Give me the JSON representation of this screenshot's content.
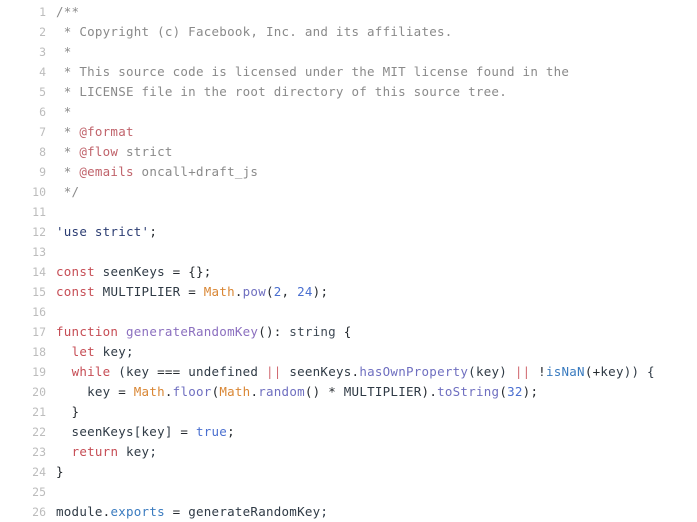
{
  "editor": {
    "language": "javascript",
    "background_color": "#ffffff",
    "gutter_color": "#bcbcbc",
    "default_text_color": "#24292e",
    "total_lines": 26
  },
  "colors": {
    "comment": "#8a8a8a",
    "doc_tag": "#c0636b",
    "keyword": "#c64d55",
    "string": "#2b3c72",
    "builtin_object": "#d98634",
    "method": "#6f6fc0",
    "function_name": "#8b6fbf",
    "property": "#3a7bbf",
    "constant": "#4a6fd0",
    "operator": "#d16b72"
  },
  "lines": [
    {
      "n": "1",
      "tokens": [
        {
          "t": "/**",
          "c": "comment"
        }
      ]
    },
    {
      "n": "2",
      "tokens": [
        {
          "t": " * Copyright (c) Facebook, Inc. and its affiliates.",
          "c": "comment"
        }
      ]
    },
    {
      "n": "3",
      "tokens": [
        {
          "t": " *",
          "c": "comment"
        }
      ]
    },
    {
      "n": "4",
      "tokens": [
        {
          "t": " * This source code is licensed under the MIT license found in the",
          "c": "comment"
        }
      ]
    },
    {
      "n": "5",
      "tokens": [
        {
          "t": " * LICENSE file in the root directory of this source tree.",
          "c": "comment"
        }
      ]
    },
    {
      "n": "6",
      "tokens": [
        {
          "t": " *",
          "c": "comment"
        }
      ]
    },
    {
      "n": "7",
      "tokens": [
        {
          "t": " * ",
          "c": "comment"
        },
        {
          "t": "@format",
          "c": "doctag"
        }
      ]
    },
    {
      "n": "8",
      "tokens": [
        {
          "t": " * ",
          "c": "comment"
        },
        {
          "t": "@flow",
          "c": "doctag"
        },
        {
          "t": " strict",
          "c": "comment"
        }
      ]
    },
    {
      "n": "9",
      "tokens": [
        {
          "t": " * ",
          "c": "comment"
        },
        {
          "t": "@emails",
          "c": "doctag"
        },
        {
          "t": " oncall+draft_js",
          "c": "comment"
        }
      ]
    },
    {
      "n": "10",
      "tokens": [
        {
          "t": " */",
          "c": "comment"
        }
      ]
    },
    {
      "n": "11",
      "tokens": []
    },
    {
      "n": "12",
      "tokens": [
        {
          "t": "'use strict'",
          "c": "string"
        },
        {
          "t": ";",
          "c": "plain"
        }
      ]
    },
    {
      "n": "13",
      "tokens": []
    },
    {
      "n": "14",
      "tokens": [
        {
          "t": "const",
          "c": "keyword"
        },
        {
          "t": " seenKeys ",
          "c": "ident"
        },
        {
          "t": "=",
          "c": "plain"
        },
        {
          "t": " {};",
          "c": "plain"
        }
      ]
    },
    {
      "n": "15",
      "tokens": [
        {
          "t": "const",
          "c": "keyword"
        },
        {
          "t": " MULTIPLIER ",
          "c": "ident"
        },
        {
          "t": "=",
          "c": "plain"
        },
        {
          "t": " ",
          "c": "plain"
        },
        {
          "t": "Math",
          "c": "builtin"
        },
        {
          "t": ".",
          "c": "plain"
        },
        {
          "t": "pow",
          "c": "method"
        },
        {
          "t": "(",
          "c": "plain"
        },
        {
          "t": "2",
          "c": "const"
        },
        {
          "t": ", ",
          "c": "plain"
        },
        {
          "t": "24",
          "c": "const"
        },
        {
          "t": ");",
          "c": "plain"
        }
      ]
    },
    {
      "n": "16",
      "tokens": []
    },
    {
      "n": "17",
      "tokens": [
        {
          "t": "function",
          "c": "keyword"
        },
        {
          "t": " ",
          "c": "plain"
        },
        {
          "t": "generateRandomKey",
          "c": "func"
        },
        {
          "t": "(): ",
          "c": "plain"
        },
        {
          "t": "string",
          "c": "type"
        },
        {
          "t": " {",
          "c": "plain"
        }
      ]
    },
    {
      "n": "18",
      "tokens": [
        {
          "t": "  ",
          "c": "plain"
        },
        {
          "t": "let",
          "c": "keyword"
        },
        {
          "t": " key;",
          "c": "ident"
        }
      ]
    },
    {
      "n": "19",
      "tokens": [
        {
          "t": "  ",
          "c": "plain"
        },
        {
          "t": "while",
          "c": "keyword"
        },
        {
          "t": " (key ",
          "c": "ident"
        },
        {
          "t": "===",
          "c": "plain"
        },
        {
          "t": " undefined ",
          "c": "ident"
        },
        {
          "t": "||",
          "c": "op"
        },
        {
          "t": " seenKeys",
          "c": "ident"
        },
        {
          "t": ".",
          "c": "plain"
        },
        {
          "t": "hasOwnProperty",
          "c": "method"
        },
        {
          "t": "(key) ",
          "c": "ident"
        },
        {
          "t": "||",
          "c": "op"
        },
        {
          "t": " ",
          "c": "plain"
        },
        {
          "t": "!",
          "c": "plain"
        },
        {
          "t": "isNaN",
          "c": "prop"
        },
        {
          "t": "(",
          "c": "plain"
        },
        {
          "t": "+",
          "c": "plain"
        },
        {
          "t": "key)) {",
          "c": "ident"
        }
      ]
    },
    {
      "n": "20",
      "tokens": [
        {
          "t": "    key ",
          "c": "ident"
        },
        {
          "t": "=",
          "c": "plain"
        },
        {
          "t": " ",
          "c": "plain"
        },
        {
          "t": "Math",
          "c": "builtin"
        },
        {
          "t": ".",
          "c": "plain"
        },
        {
          "t": "floor",
          "c": "method"
        },
        {
          "t": "(",
          "c": "plain"
        },
        {
          "t": "Math",
          "c": "builtin"
        },
        {
          "t": ".",
          "c": "plain"
        },
        {
          "t": "random",
          "c": "method"
        },
        {
          "t": "() ",
          "c": "plain"
        },
        {
          "t": "*",
          "c": "plain"
        },
        {
          "t": " ",
          "c": "plain"
        },
        {
          "t": "MULTIPLIER",
          "c": "ident"
        },
        {
          "t": ").",
          "c": "plain"
        },
        {
          "t": "toString",
          "c": "method"
        },
        {
          "t": "(",
          "c": "plain"
        },
        {
          "t": "32",
          "c": "const"
        },
        {
          "t": ");",
          "c": "plain"
        }
      ]
    },
    {
      "n": "21",
      "tokens": [
        {
          "t": "  }",
          "c": "plain"
        }
      ]
    },
    {
      "n": "22",
      "tokens": [
        {
          "t": "  seenKeys[key] ",
          "c": "ident"
        },
        {
          "t": "=",
          "c": "plain"
        },
        {
          "t": " ",
          "c": "plain"
        },
        {
          "t": "true",
          "c": "const"
        },
        {
          "t": ";",
          "c": "plain"
        }
      ]
    },
    {
      "n": "23",
      "tokens": [
        {
          "t": "  ",
          "c": "plain"
        },
        {
          "t": "return",
          "c": "keyword"
        },
        {
          "t": " key;",
          "c": "ident"
        }
      ]
    },
    {
      "n": "24",
      "tokens": [
        {
          "t": "}",
          "c": "plain"
        }
      ]
    },
    {
      "n": "25",
      "tokens": []
    },
    {
      "n": "26",
      "tokens": [
        {
          "t": "module",
          "c": "ident"
        },
        {
          "t": ".",
          "c": "plain"
        },
        {
          "t": "exports",
          "c": "prop"
        },
        {
          "t": " ",
          "c": "plain"
        },
        {
          "t": "=",
          "c": "plain"
        },
        {
          "t": " generateRandomKey;",
          "c": "ident"
        }
      ]
    }
  ]
}
